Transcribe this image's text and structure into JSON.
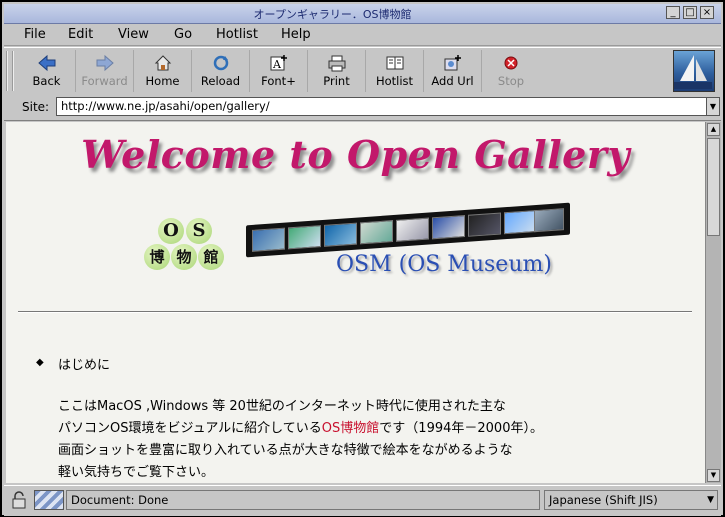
{
  "window": {
    "title": "オープンギャラリー．OS博物館"
  },
  "menu": {
    "file": "File",
    "edit": "Edit",
    "view": "View",
    "go": "Go",
    "hotlist": "Hotlist",
    "help": "Help"
  },
  "toolbar": {
    "back": "Back",
    "forward": "Forward",
    "home": "Home",
    "reload": "Reload",
    "font_plus": "Font+",
    "print": "Print",
    "hotlist": "Hotlist",
    "add_url": "Add Url",
    "stop": "Stop"
  },
  "site": {
    "label": "Site:",
    "url": "http://www.ne.jp/asahi/open/gallery/"
  },
  "page": {
    "welcome": "Welcome to Open Gallery",
    "os_logo": {
      "o": "O",
      "s": "S",
      "c1": "博",
      "c2": "物",
      "c3": "館"
    },
    "osm_caption": "OSM (OS Museum)",
    "intro_heading": "はじめに",
    "para_line1": "ここはMacOS ,Windows 等 20世紀のインターネット時代に使用された主な",
    "para_line2_pre": "パソコンOS環境をビジュアルに紹介している",
    "para_line2_link": "OS博物館",
    "para_line2_post": "です（1994年－2000年）。",
    "para_line3": "画面ショットを豊富に取り入れている点が大きな特徴で絵本をながめるような",
    "para_line4": "軽い気持ちでご覧下さい。"
  },
  "status": {
    "text": "Document: Done",
    "encoding": "Japanese (Shift JIS)"
  },
  "colors": {
    "welcome": "#c2186b",
    "link": "#c8102e",
    "osm": "#2a4fb4",
    "background": "#f3f3ef"
  }
}
